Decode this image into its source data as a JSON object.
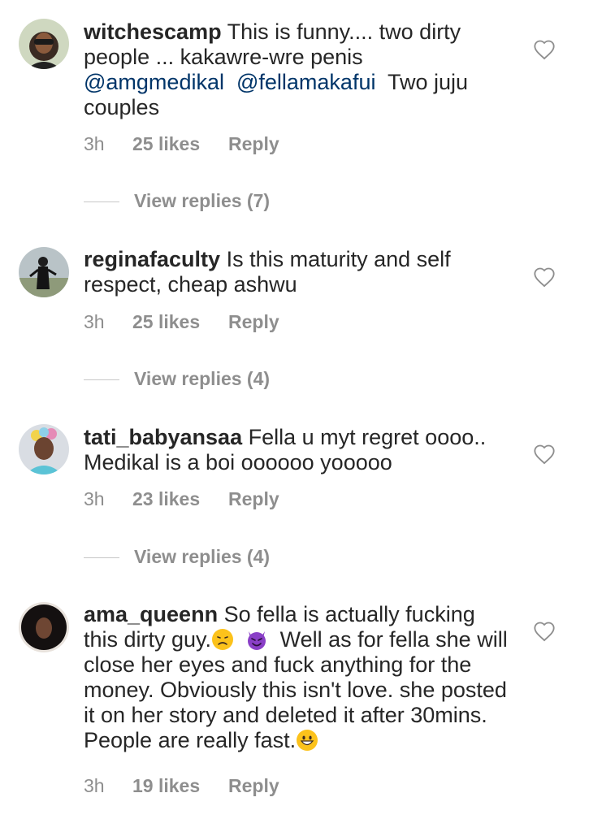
{
  "comments": [
    {
      "username": "witchescamp",
      "text_1": "This is funny.... two dirty people ... kakawre-wre penis",
      "mention_1": "@amgmedikal",
      "mention_2": "@fellamakafui",
      "text_2": "Two juju couples",
      "time": "3h",
      "likes": "25 likes",
      "reply": "Reply",
      "view_replies": "View replies (7)"
    },
    {
      "username": "reginafaculty",
      "text": "Is this maturity and self respect, cheap ashwu",
      "time": "3h",
      "likes": "25 likes",
      "reply": "Reply",
      "view_replies": "View replies (4)"
    },
    {
      "username": "tati_babyansaa",
      "text": "Fella u myt regret oooo.. Medikal is a  boi oooooo yooooo",
      "time": "3h",
      "likes": "23 likes",
      "reply": "Reply",
      "view_replies": "View replies (4)"
    },
    {
      "username": "ama_queenn",
      "text_1": "So fella is actually fucking this dirty guy.",
      "text_2": "Well as for fella she will close her eyes and fuck anything for the money. Obviously this isn't love. she posted it on her story and deleted it after 30mins. People are really fast.",
      "time": "3h",
      "likes": "19 likes",
      "reply": "Reply"
    }
  ],
  "icons": {
    "like": "heart-outline-icon",
    "emoji_1": "disappointed-face-emoji",
    "emoji_2": "smiling-devil-emoji",
    "emoji_3": "grinning-face-emoji"
  },
  "colors": {
    "text": "#262626",
    "meta": "#8e8e8e",
    "mention": "#003569"
  }
}
